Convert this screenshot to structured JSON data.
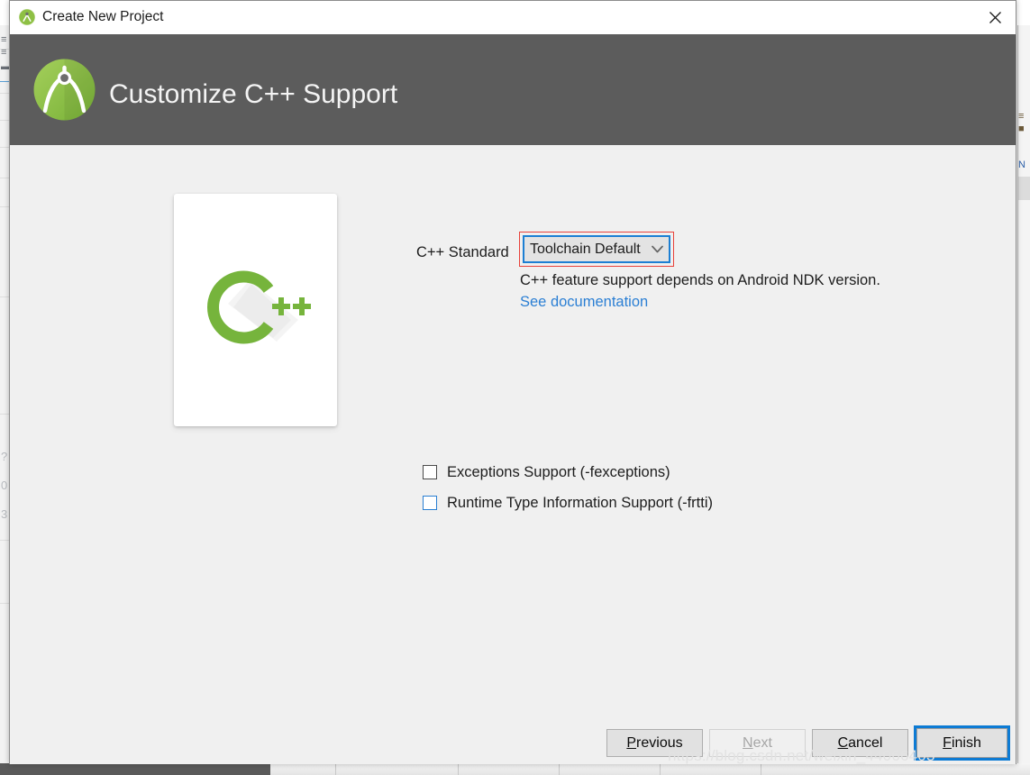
{
  "window": {
    "title": "Create New Project",
    "title_icon": "android-studio-icon",
    "close_icon": "close-icon"
  },
  "header": {
    "title": "Customize C++ Support",
    "logo_icon": "android-studio-logo"
  },
  "illustration": {
    "name": "cpp-logo",
    "letter": "C",
    "plus": "++"
  },
  "form": {
    "standard_label": "C++ Standard",
    "standard_value": "Toolchain Default",
    "standard_chevron_icon": "chevron-down-icon",
    "help_text": "C++ feature support depends on Android NDK version.",
    "documentation_link": "See documentation",
    "checkboxes": [
      {
        "label": "Exceptions Support (-fexceptions)",
        "checked": false,
        "focused": false
      },
      {
        "label": "Runtime Type Information Support (-frtti)",
        "checked": false,
        "focused": true
      }
    ]
  },
  "footer": {
    "previous": {
      "pre": "",
      "mnemonic": "P",
      "post": "revious",
      "disabled": false
    },
    "next": {
      "pre": "",
      "mnemonic": "N",
      "post": "ext",
      "disabled": true
    },
    "cancel": {
      "pre": "",
      "mnemonic": "C",
      "post": "ancel",
      "disabled": false
    },
    "finish": {
      "pre": "",
      "mnemonic": "F",
      "post": "inish",
      "disabled": false,
      "focused": true
    }
  },
  "watermark": "https://blog.csdn.net/weixin_44066403",
  "background": {
    "left_ghost_chars": [
      "?",
      "0",
      "3"
    ],
    "right_ghost_chars": [
      "≡",
      "■",
      "N"
    ]
  },
  "colors": {
    "header_bg": "#5c5c5c",
    "body_bg": "#f0f0f0",
    "accent_blue": "#0d7bd4",
    "link_blue": "#2b7fd4",
    "annotation_red": "#e8423b",
    "cpp_green": "#76b43c"
  }
}
